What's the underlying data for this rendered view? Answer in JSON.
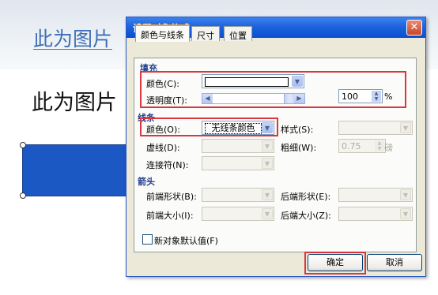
{
  "slide": {
    "title": "此为图片",
    "body": "此为图片"
  },
  "dialog": {
    "title": "设置对象格式",
    "close_glyph": "✕",
    "tabs": [
      "颜色与线条",
      "尺寸",
      "位置"
    ],
    "fill": {
      "section_label": "填充",
      "color_label": "颜色(C):",
      "transparency_label": "透明度(T):",
      "transparency_value": "100",
      "transparency_unit": "%"
    },
    "line": {
      "section_label": "线条",
      "color_label": "颜色(O):",
      "color_value": "无线条颜色",
      "style_label": "样式(S):",
      "dashed_label": "虚线(D):",
      "weight_label": "粗细(W):",
      "weight_value": "0.75",
      "weight_unit": "磅",
      "connector_label": "连接符(N):"
    },
    "arrows": {
      "section_label": "箭头",
      "begin_style_label": "前端形状(B):",
      "end_style_label": "后端形状(E):",
      "begin_size_label": "前端大小(I):",
      "end_size_label": "后端大小(Z):"
    },
    "default_checkbox_label": "新对象默认值(F)",
    "ok_label": "确定",
    "cancel_label": "取消"
  },
  "colors": {
    "titlebar": "#1e63dd",
    "dialog_bg": "#ece9d8",
    "highlight_box": "#d9363e",
    "shape_fill": "#1c58c4"
  }
}
